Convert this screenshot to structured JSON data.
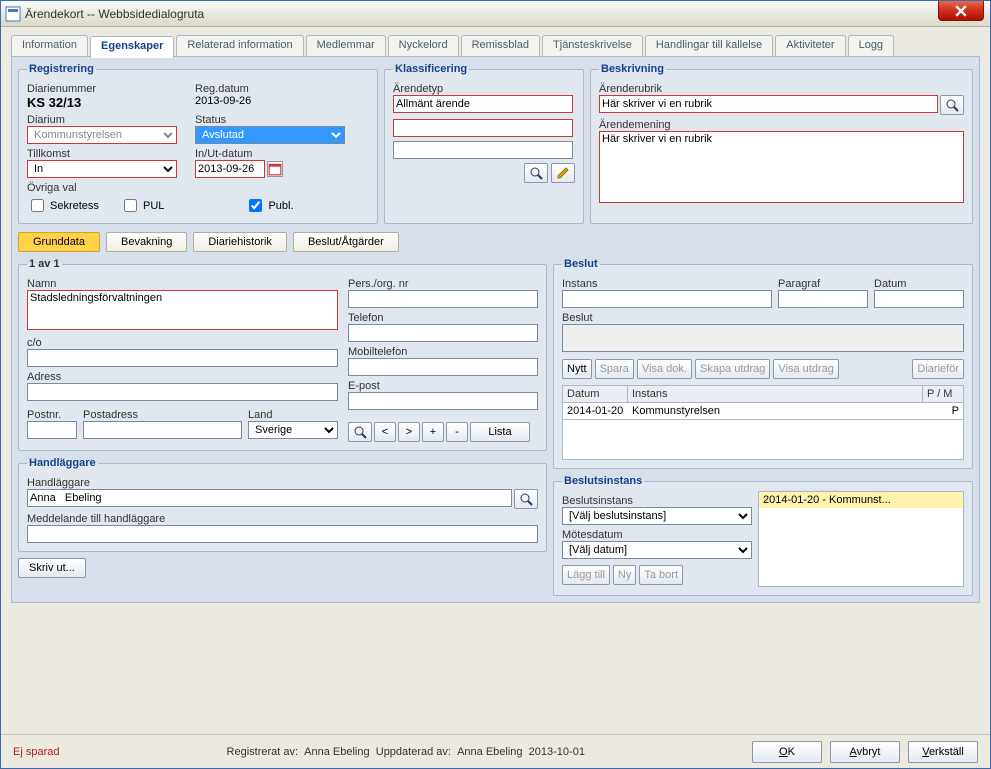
{
  "window": {
    "title": "Ärendekort -- Webbsidedialogruta"
  },
  "tabs": [
    "Information",
    "Egenskaper",
    "Relaterad information",
    "Medlemmar",
    "Nyckelord",
    "Remissblad",
    "Tjänsteskrivelse",
    "Handlingar till kallelse",
    "Aktiviteter",
    "Logg"
  ],
  "tabs_active_index": 1,
  "registrering": {
    "legend": "Registrering",
    "diarienummer_lbl": "Diarienummer",
    "diarienummer": "KS 32/13",
    "regdatum_lbl": "Reg.datum",
    "regdatum": "2013-09-26",
    "diarium_lbl": "Diarium",
    "diarium": "Kommunstyrelsen",
    "status_lbl": "Status",
    "status": "Avslutad",
    "tillkomst_lbl": "Tillkomst",
    "tillkomst": "In",
    "inut_lbl": "In/Ut-datum",
    "inut": "2013-09-26",
    "ovriga_lbl": "Övriga val",
    "sekretess": "Sekretess",
    "pul": "PUL",
    "publ": "Publ.",
    "publ_checked": true
  },
  "klass": {
    "legend": "Klassificering",
    "arendetyp_lbl": "Ärendetyp",
    "arendetyp": "Allmänt ärende"
  },
  "besk": {
    "legend": "Beskrivning",
    "rubrik_lbl": "Ärenderubrik",
    "rubrik": "Här skriver vi en rubrik",
    "mening_lbl": "Ärendemening",
    "mening": "Här skriver vi en rubrik"
  },
  "subtabs": [
    "Grunddata",
    "Bevakning",
    "Diariehistorik",
    "Beslut/Åtgärder"
  ],
  "subtabs_active_index": 0,
  "grunddata": {
    "counter": "1 av 1",
    "namn_lbl": "Namn",
    "namn": "Stadsledningsförvaltningen",
    "persorg_lbl": "Pers./org. nr",
    "co_lbl": "c/o",
    "tel_lbl": "Telefon",
    "mobil_lbl": "Mobiltelefon",
    "adress_lbl": "Adress",
    "epost_lbl": "E-post",
    "postnr_lbl": "Postnr.",
    "postadr_lbl": "Postadress",
    "land_lbl": "Land",
    "land": "Sverige",
    "lista_btn": "Lista"
  },
  "handlaggare": {
    "legend": "Handläggare",
    "lbl": "Handläggare",
    "value": "Anna   Ebeling",
    "meddelande_lbl": "Meddelande till handläggare"
  },
  "skrivut": "Skriv ut...",
  "beslut": {
    "legend": "Beslut",
    "instans_lbl": "Instans",
    "paragraf_lbl": "Paragraf",
    "datum_lbl": "Datum",
    "beslut_lbl": "Beslut",
    "nytt": "Nytt",
    "spara": "Spara",
    "visa_dok": "Visa dok.",
    "skapa_utdrag": "Skapa utdrag",
    "visa_utdrag": "Visa utdrag",
    "diariefor": "Diarieför",
    "table": {
      "headers": [
        "Datum",
        "Instans",
        "P / M"
      ],
      "rows": [
        {
          "datum": "2014-01-20",
          "instans": "Kommunstyrelsen",
          "pm": "P"
        }
      ]
    }
  },
  "beslutsinstans": {
    "legend": "Beslutsinstans",
    "lbl": "Beslutsinstans",
    "value": "[Välj beslutsinstans]",
    "motes_lbl": "Mötesdatum",
    "motes_value": "[Välj datum]",
    "laggtill": "Lägg till",
    "ny": "Ny",
    "tabort": "Ta bort",
    "list_item": "2014-01-20 - Kommunst..."
  },
  "footer": {
    "ej_sparad": "Ej sparad",
    "reg_by_lbl": "Registrerat av:",
    "reg_by": "Anna Ebeling",
    "upd_by_lbl": "Uppdaterad av:",
    "upd_by": "Anna Ebeling",
    "upd_date": "2013-10-01",
    "ok": "OK",
    "avbryt": "Avbryt",
    "verkstall": "Verkställ"
  }
}
